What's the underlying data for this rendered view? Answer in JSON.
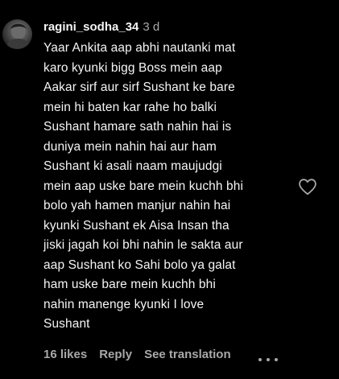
{
  "comment": {
    "username": "ragini_sodha_34",
    "timestamp": "3 d",
    "text": "Yaar Ankita aap abhi nautanki mat\nkaro kyunki bigg Boss mein aap\nAakar sirf aur sirf Sushant ke bare\nmein hi baten kar rahe ho balki\nSushant hamare sath nahin hai is\nduniya mein nahin hai aur ham\nSushant ki asali naam maujudgi\nmein aap uske bare mein kuchh bhi\nbolo yah hamen manjur nahin hai\nkyunki Sushant ek Aisa Insan tha\njiski jagah koi bhi nahin le sakta aur\naap Sushant ko Sahi bolo ya galat\nham uske bare mein kuchh bhi\nnahin manenge kyunki I love\nSushant",
    "likes": "16 likes",
    "reply_label": "Reply",
    "translation_label": "See translation"
  },
  "icons": {
    "avatar": "avatar-image",
    "like": "heart-outline-icon",
    "more": "more-options-icon"
  },
  "colors": {
    "background": "#000000",
    "primary_text": "#f5f5f5",
    "secondary_text": "#a8a8a8"
  }
}
